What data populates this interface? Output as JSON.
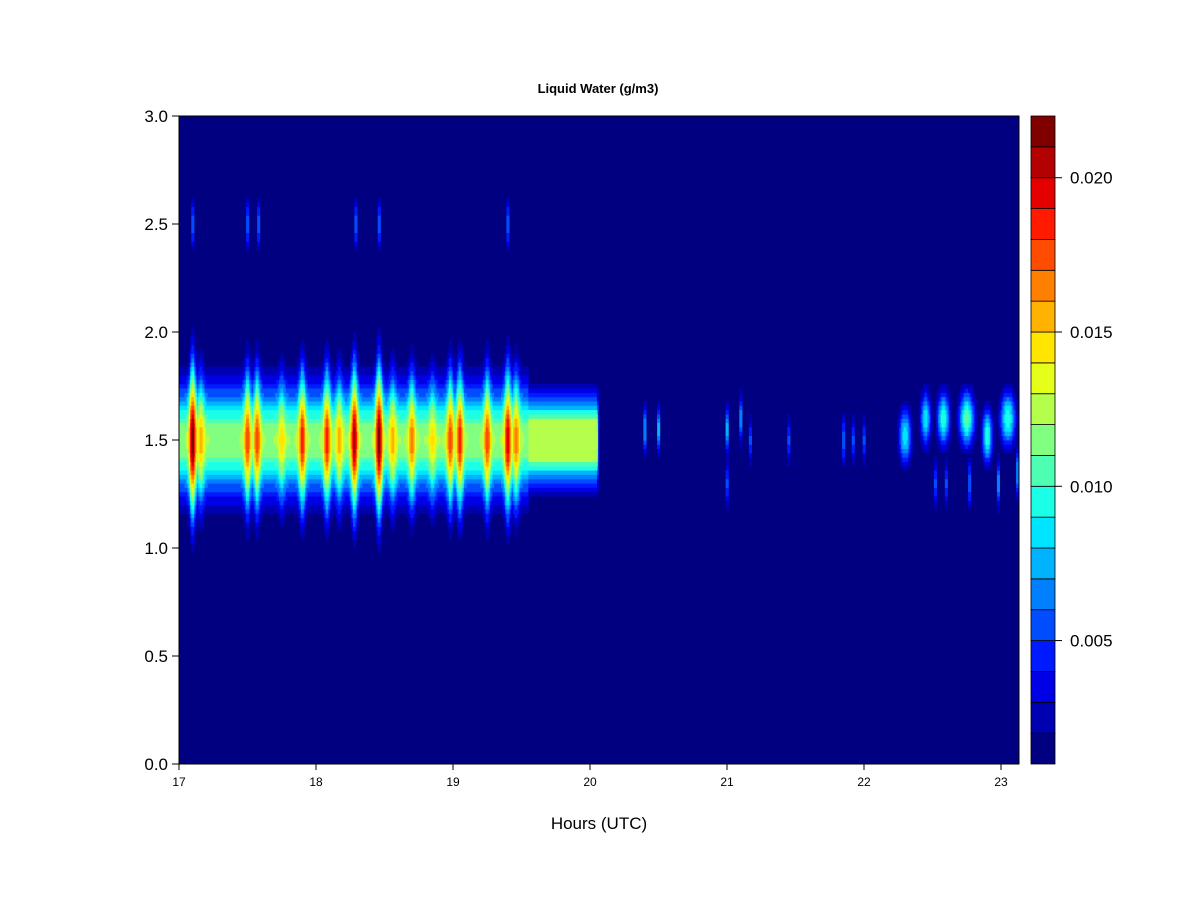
{
  "chart_data": {
    "type": "heatmap",
    "title": "Liquid Water (g/m3)",
    "xlabel": "Hours (UTC)",
    "ylabel": "",
    "xlim": [
      17,
      23.13
    ],
    "ylim": [
      0,
      3
    ],
    "xticks": [
      "17",
      "18",
      "19",
      "20",
      "21",
      "22",
      "23"
    ],
    "yticks": [
      "0.0",
      "0.5",
      "1.0",
      "1.5",
      "2.0",
      "2.5",
      "3.0"
    ],
    "colorbar": {
      "levels_min": 0.001,
      "levels_max": 0.022,
      "level_step": 0.001,
      "ticks": [
        "0.005",
        "0.010",
        "0.015",
        "0.020"
      ],
      "colormap": "jet"
    },
    "main_cloud_layer": {
      "x_range": [
        17.0,
        20.07
      ],
      "center_height_km": 1.5,
      "baseline_peak": 0.012,
      "peaks": [
        {
          "x": 17.1,
          "z": 0.022
        },
        {
          "x": 17.16,
          "z": 0.016
        },
        {
          "x": 17.5,
          "z": 0.018
        },
        {
          "x": 17.57,
          "z": 0.018
        },
        {
          "x": 17.75,
          "z": 0.015
        },
        {
          "x": 17.9,
          "z": 0.019
        },
        {
          "x": 18.08,
          "z": 0.019
        },
        {
          "x": 18.17,
          "z": 0.016
        },
        {
          "x": 18.28,
          "z": 0.021
        },
        {
          "x": 18.46,
          "z": 0.022
        },
        {
          "x": 18.56,
          "z": 0.016
        },
        {
          "x": 18.7,
          "z": 0.017
        },
        {
          "x": 18.85,
          "z": 0.015
        },
        {
          "x": 18.98,
          "z": 0.018
        },
        {
          "x": 19.05,
          "z": 0.019
        },
        {
          "x": 19.25,
          "z": 0.018
        },
        {
          "x": 19.4,
          "z": 0.02
        },
        {
          "x": 19.46,
          "z": 0.017
        }
      ]
    },
    "blobs": [
      {
        "x": 17.1,
        "y": 2.5,
        "z": 0.007
      },
      {
        "x": 17.5,
        "y": 2.5,
        "z": 0.007
      },
      {
        "x": 17.58,
        "y": 2.5,
        "z": 0.007
      },
      {
        "x": 18.29,
        "y": 2.5,
        "z": 0.007
      },
      {
        "x": 18.46,
        "y": 2.5,
        "z": 0.007
      },
      {
        "x": 19.4,
        "y": 2.5,
        "z": 0.007
      },
      {
        "x": 20.4,
        "y": 1.55,
        "z": 0.008
      },
      {
        "x": 20.5,
        "y": 1.55,
        "z": 0.009
      },
      {
        "x": 21.0,
        "y": 1.55,
        "z": 0.009
      },
      {
        "x": 21.0,
        "y": 1.3,
        "z": 0.006
      },
      {
        "x": 21.1,
        "y": 1.6,
        "z": 0.008
      },
      {
        "x": 21.17,
        "y": 1.5,
        "z": 0.006
      },
      {
        "x": 21.45,
        "y": 1.5,
        "z": 0.006
      },
      {
        "x": 21.85,
        "y": 1.5,
        "z": 0.007
      },
      {
        "x": 21.92,
        "y": 1.5,
        "z": 0.006
      },
      {
        "x": 22.0,
        "y": 1.5,
        "z": 0.006
      },
      {
        "x": 22.52,
        "y": 1.3,
        "z": 0.006
      },
      {
        "x": 22.6,
        "y": 1.3,
        "z": 0.006
      },
      {
        "x": 22.77,
        "y": 1.3,
        "z": 0.007
      },
      {
        "x": 22.98,
        "y": 1.3,
        "z": 0.008
      },
      {
        "x": 23.12,
        "y": 1.35,
        "z": 0.008
      }
    ],
    "late_layer": [
      {
        "x": 22.3,
        "y": 1.52,
        "z": 0.009,
        "wx": 0.05
      },
      {
        "x": 22.45,
        "y": 1.6,
        "z": 0.009,
        "wx": 0.04
      },
      {
        "x": 22.58,
        "y": 1.6,
        "z": 0.01,
        "wx": 0.05
      },
      {
        "x": 22.75,
        "y": 1.6,
        "z": 0.011,
        "wx": 0.06
      },
      {
        "x": 22.9,
        "y": 1.52,
        "z": 0.01,
        "wx": 0.04
      },
      {
        "x": 23.05,
        "y": 1.6,
        "z": 0.01,
        "wx": 0.06
      }
    ]
  }
}
